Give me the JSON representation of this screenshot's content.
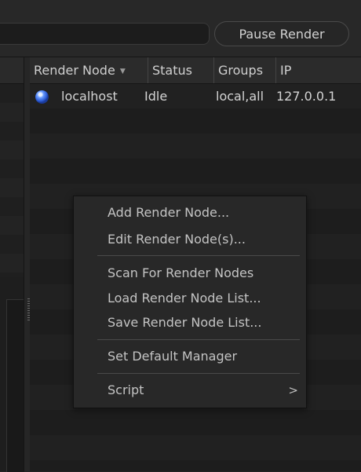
{
  "toolbar": {
    "search_value": "",
    "pause_render_label": "Pause Render"
  },
  "table": {
    "columns": [
      {
        "label": "Render Node",
        "sorted": true
      },
      {
        "label": "Status"
      },
      {
        "label": "Groups"
      },
      {
        "label": "IP"
      }
    ],
    "rows": [
      {
        "name": "localhost",
        "status": "Idle",
        "groups": "local,all",
        "ip": "127.0.0.1",
        "status_icon": "blue-sphere-icon"
      }
    ]
  },
  "context_menu": {
    "items": [
      {
        "label": "Add Render Node..."
      },
      {
        "label": "Edit Render Node(s)..."
      },
      {
        "label": "Scan For Render Nodes"
      },
      {
        "label": "Load Render Node List..."
      },
      {
        "label": "Save Render Node List..."
      },
      {
        "label": "Set Default Manager"
      },
      {
        "label": "Script",
        "submenu_icon": "chevron-right-icon"
      }
    ]
  },
  "colors": {
    "background": "#232323",
    "menu_background": "#282828",
    "node_dot": "#2f5fd8"
  }
}
